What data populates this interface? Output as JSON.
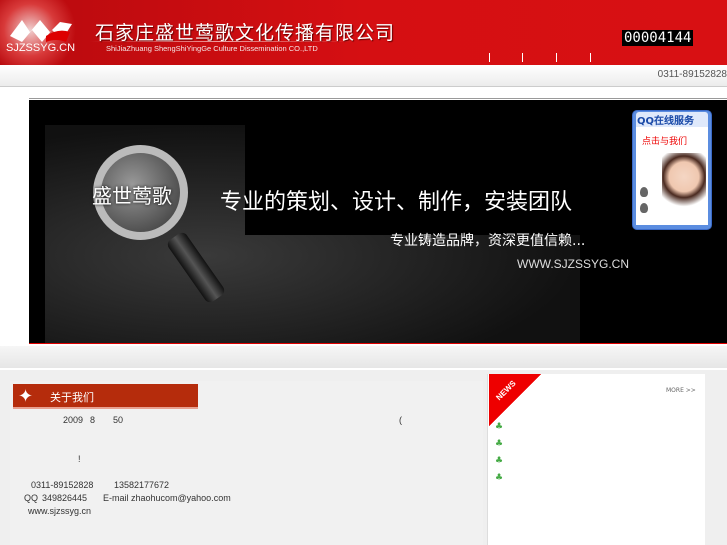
{
  "header": {
    "logo_domain": "SJZSSYG.CN",
    "company_cn": "石家庄盛世莺歌文化传播有限公司",
    "company_en": "ShiJiaZhuang ShengShiYingGe Culture Dissemination CO.,LTD",
    "visitor_counter": "00004144",
    "phone": "0311-89152828"
  },
  "banner": {
    "brand_cn": "盛世莺歌",
    "slogan_main": "专业的策划、设计、制作，安装团队",
    "slogan_sub": "专业铸造品牌，资深更值信赖...",
    "website": "WWW.SJZSSYG.CN"
  },
  "qq_service": {
    "title": "QQ在线服务",
    "cta": "点击与我们"
  },
  "about": {
    "tab_label": "关于我们",
    "line1_year": "2009",
    "line1_month": "8",
    "line1_num": "50",
    "line1_paren": "(",
    "exclaim": "!",
    "phone": "0311-89152828",
    "mobile": "13582177672",
    "qq_label": "QQ",
    "qq": "349826445",
    "email_label": "E-mail",
    "email": "zhaohucom@yahoo.com",
    "website": "www.sjzssyg.cn"
  },
  "news": {
    "label": "NEWS",
    "more": "MORE >>",
    "item_count": 4
  },
  "colors": {
    "header_red": "#d50f12",
    "about_tab": "#b52c0c"
  }
}
